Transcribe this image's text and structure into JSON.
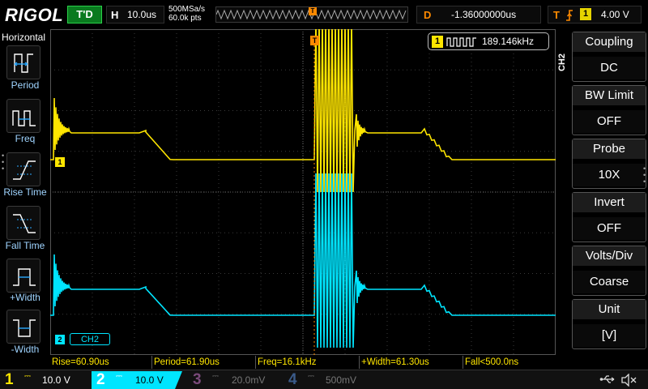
{
  "topbar": {
    "brand": "RIGOL",
    "run_state": "T'D",
    "timebase_label": "H",
    "timebase_value": "10.0us",
    "sample_rate": "500MSa/s",
    "memory_depth": "60.0k pts",
    "trigger_pos_marker": "T",
    "delay_label": "D",
    "delay_value": "-1.36000000us",
    "trigger_label": "T",
    "trigger_source": "1",
    "trigger_level": "4.00 V"
  },
  "left_panel": {
    "title": "Horizontal",
    "items": [
      {
        "label": "Period",
        "icon": "period-icon"
      },
      {
        "label": "Freq",
        "icon": "freq-icon"
      },
      {
        "label": "Rise Time",
        "icon": "rise-time-icon"
      },
      {
        "label": "Fall Time",
        "icon": "fall-time-icon"
      },
      {
        "label": "+Width",
        "icon": "pos-width-icon"
      },
      {
        "label": "-Width",
        "icon": "neg-width-icon"
      }
    ]
  },
  "screen": {
    "counter_channel": "1",
    "counter_value": "189.146kHz",
    "trigger_marker": "T",
    "ch1_marker": "1",
    "ch2_marker": "2",
    "ch2_tag": "CH2",
    "trigger_level_marker": "T"
  },
  "right_panel": {
    "channel_label": "CH2",
    "items": [
      {
        "title": "Coupling",
        "value": "DC"
      },
      {
        "title": "BW Limit",
        "value": "OFF"
      },
      {
        "title": "Probe",
        "value": "10X"
      },
      {
        "title": "Invert",
        "value": "OFF"
      },
      {
        "title": "Volts/Div",
        "value": "Coarse"
      },
      {
        "title": "Unit",
        "value": "[V]"
      }
    ]
  },
  "measurements": [
    {
      "text": "Rise=60.90us"
    },
    {
      "text": "Period=61.90us"
    },
    {
      "text": "Freq=16.1kHz"
    },
    {
      "text": "+Width=61.30us"
    },
    {
      "text": "Fall<500.0ns"
    }
  ],
  "channels": [
    {
      "num": "1",
      "coupling": "DC",
      "scale": "10.0 V",
      "color": "#ffe600",
      "active": true
    },
    {
      "num": "2",
      "coupling": "DC",
      "scale": "10.0 V",
      "color": "#00e5ff",
      "active": true
    },
    {
      "num": "3",
      "coupling": "DC",
      "scale": "20.0mV",
      "color": "#c040c0",
      "active": false
    },
    {
      "num": "4",
      "coupling": "DC",
      "scale": "500mV",
      "color": "#3a7bd5",
      "active": false
    }
  ],
  "colors": {
    "ch1": "#ffe600",
    "ch2": "#00e5ff",
    "trigger": "#ff8a00",
    "run_state_bg": "#0a7a1f",
    "menu_highlight": "#2aa9ff"
  }
}
